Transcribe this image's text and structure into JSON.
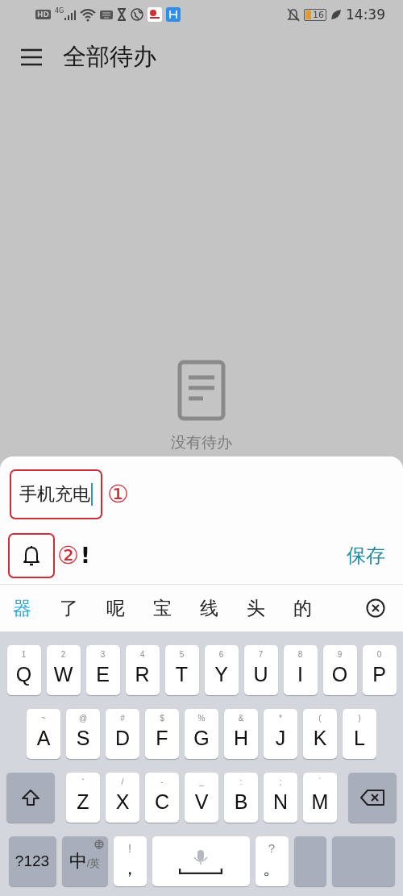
{
  "status_bar": {
    "hd_badge": "HD",
    "network": "4G",
    "battery": "16",
    "time": "14:39"
  },
  "app_bar": {
    "title": "全部待办"
  },
  "empty_state": {
    "text": "没有待办"
  },
  "sheet": {
    "input": {
      "value": "手机充电"
    },
    "annotations": [
      "①",
      "②"
    ],
    "priority_mark": "!",
    "save": "保存"
  },
  "candidates": [
    {
      "text": "器",
      "selected": true
    },
    {
      "text": "了",
      "selected": false
    },
    {
      "text": "呢",
      "selected": false
    },
    {
      "text": "宝",
      "selected": false
    },
    {
      "text": "线",
      "selected": false
    },
    {
      "text": "头",
      "selected": false
    },
    {
      "text": "的",
      "selected": false
    }
  ],
  "keyboard": {
    "rows": [
      [
        {
          "kind": "letter",
          "label": "Q",
          "hint": "1"
        },
        {
          "kind": "letter",
          "label": "W",
          "hint": "2"
        },
        {
          "kind": "letter",
          "label": "E",
          "hint": "3"
        },
        {
          "kind": "letter",
          "label": "R",
          "hint": "4"
        },
        {
          "kind": "letter",
          "label": "T",
          "hint": "5"
        },
        {
          "kind": "letter",
          "label": "Y",
          "hint": "6"
        },
        {
          "kind": "letter",
          "label": "U",
          "hint": "7"
        },
        {
          "kind": "letter",
          "label": "I",
          "hint": "8"
        },
        {
          "kind": "letter",
          "label": "O",
          "hint": "9"
        },
        {
          "kind": "letter",
          "label": "P",
          "hint": "0"
        }
      ],
      [
        {
          "kind": "letter",
          "label": "A",
          "hint": "~"
        },
        {
          "kind": "letter",
          "label": "S",
          "hint": "@"
        },
        {
          "kind": "letter",
          "label": "D",
          "hint": "#"
        },
        {
          "kind": "letter",
          "label": "F",
          "hint": "$"
        },
        {
          "kind": "letter",
          "label": "G",
          "hint": "%"
        },
        {
          "kind": "letter",
          "label": "H",
          "hint": "&"
        },
        {
          "kind": "letter",
          "label": "J",
          "hint": "*"
        },
        {
          "kind": "letter",
          "label": "K",
          "hint": "("
        },
        {
          "kind": "letter",
          "label": "L",
          "hint": ")"
        }
      ],
      [
        {
          "kind": "shift"
        },
        {
          "kind": "letter",
          "label": "Z",
          "hint": "'"
        },
        {
          "kind": "letter",
          "label": "X",
          "hint": "/"
        },
        {
          "kind": "letter",
          "label": "C",
          "hint": "-"
        },
        {
          "kind": "letter",
          "label": "V",
          "hint": "_"
        },
        {
          "kind": "letter",
          "label": "B",
          "hint": ":"
        },
        {
          "kind": "letter",
          "label": "N",
          "hint": ";"
        },
        {
          "kind": "letter",
          "label": "M",
          "hint": "`"
        },
        {
          "kind": "delete"
        }
      ],
      [
        {
          "kind": "fn",
          "label": "?123"
        },
        {
          "kind": "lang",
          "label": "中",
          "sub": "/英"
        },
        {
          "kind": "punct",
          "label": "，",
          "hint": "!"
        },
        {
          "kind": "space"
        },
        {
          "kind": "punct",
          "label": "。",
          "hint": "?"
        },
        {
          "kind": "blank"
        },
        {
          "kind": "action"
        }
      ]
    ]
  }
}
